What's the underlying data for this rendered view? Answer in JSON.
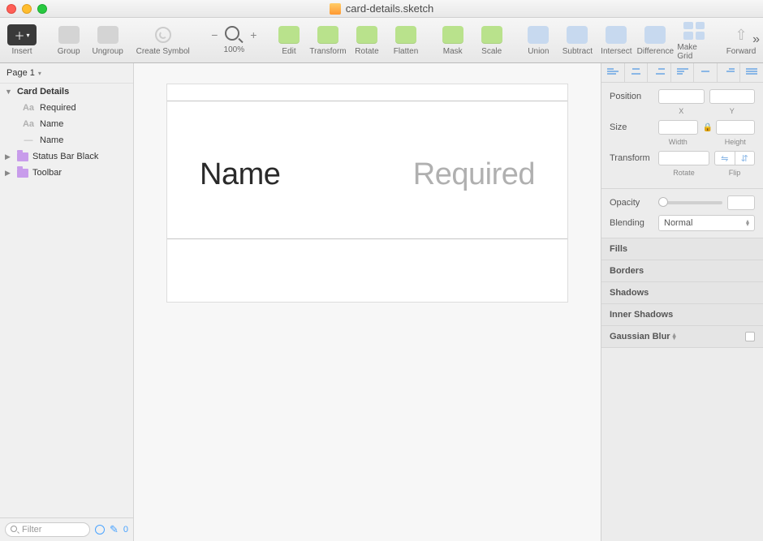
{
  "window": {
    "title": "card-details.sketch"
  },
  "toolbar": {
    "insert": "Insert",
    "group": "Group",
    "ungroup": "Ungroup",
    "create_symbol": "Create Symbol",
    "zoom_value": "100%",
    "edit": "Edit",
    "transform": "Transform",
    "rotate": "Rotate",
    "flatten": "Flatten",
    "mask": "Mask",
    "scale": "Scale",
    "union": "Union",
    "subtract": "Subtract",
    "intersect": "Intersect",
    "difference": "Difference",
    "make_grid": "Make Grid",
    "forward": "Forward"
  },
  "pages": {
    "header": "Page 1"
  },
  "layers": {
    "artboard": "Card Details",
    "required": "Required",
    "name_text": "Name",
    "name_shape": "Name",
    "status_bar": "Status Bar Black",
    "toolbar_folder": "Toolbar"
  },
  "footer": {
    "filter_placeholder": "Filter",
    "count": "0"
  },
  "canvas": {
    "name_label": "Name",
    "required_label": "Required"
  },
  "inspector": {
    "position": "Position",
    "x": "X",
    "y": "Y",
    "size": "Size",
    "width": "Width",
    "height": "Height",
    "transform": "Transform",
    "rotate": "Rotate",
    "flip": "Flip",
    "opacity": "Opacity",
    "blending": "Blending",
    "blending_value": "Normal",
    "fills": "Fills",
    "borders": "Borders",
    "shadows": "Shadows",
    "inner_shadows": "Inner Shadows",
    "gaussian_blur": "Gaussian Blur"
  }
}
